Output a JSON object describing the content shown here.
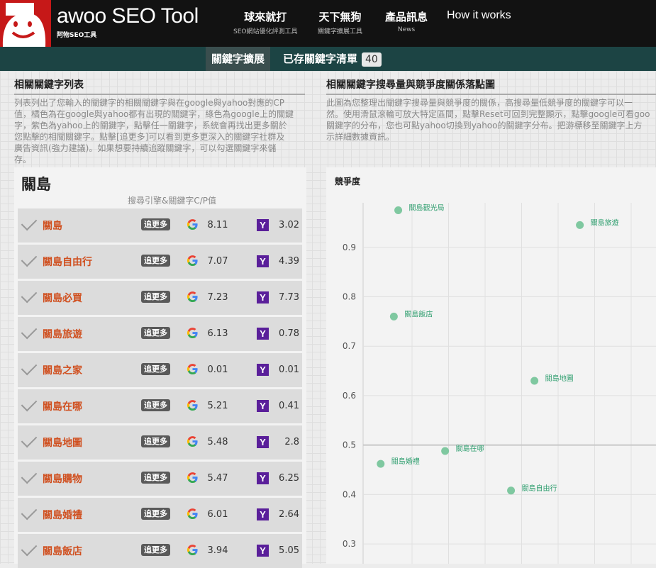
{
  "header": {
    "brand": "awoo SEO Tool",
    "brand_sub": "阿物SEO工具",
    "nav": [
      {
        "label": "球來就打",
        "sub": "SEO網站優化評測工具"
      },
      {
        "label": "天下無狗",
        "sub": "關鍵字擴展工具"
      },
      {
        "label": "產品訊息",
        "sub": "News"
      },
      {
        "label": "How it works",
        "sub": ""
      }
    ]
  },
  "subnav": {
    "tab_expand": "關鍵字擴展",
    "tab_saved": "已存關鍵字清單",
    "saved_count": "40"
  },
  "left": {
    "title": "相關關鍵字列表",
    "desc_lines": [
      "列表列出了您輸入的關鍵字的相關關鍵字與在google與yahoo對應的CP",
      "值，橘色為在google與yahoo都有出現的關鍵字，綠色為google上的關鍵",
      "字，紫色為yahoo上的關鍵字，點擊任一關鍵字，系統會再找出更多關於",
      "您點擊的相關關鍵字。點擊[追更多]可以看到更多更深入的關鍵字社群及",
      "廣告資訊(強力建議)。如果想要持續追蹤關鍵字，可以勾選關鍵字來儲",
      "存。"
    ],
    "keyword": "關島",
    "col_header": "搜尋引擎&關鍵字C/P值",
    "more_label": "追更多",
    "rows": [
      {
        "kw": "關島",
        "g": "8.11",
        "y": "3.02"
      },
      {
        "kw": "關島自由行",
        "g": "7.07",
        "y": "4.39"
      },
      {
        "kw": "關島必買",
        "g": "7.23",
        "y": "7.73"
      },
      {
        "kw": "關島旅遊",
        "g": "6.13",
        "y": "0.78"
      },
      {
        "kw": "關島之家",
        "g": "0.01",
        "y": "0.01"
      },
      {
        "kw": "關島在哪",
        "g": "5.21",
        "y": "0.41"
      },
      {
        "kw": "關島地圖",
        "g": "5.48",
        "y": "2.8"
      },
      {
        "kw": "關島購物",
        "g": "5.47",
        "y": "6.25"
      },
      {
        "kw": "關島婚禮",
        "g": "6.01",
        "y": "2.64"
      },
      {
        "kw": "關島飯店",
        "g": "3.94",
        "y": "5.05"
      }
    ]
  },
  "right": {
    "title": "相關關鍵字搜尋量與競爭度關係落點圖",
    "desc_lines": [
      "此圖為您整理出關鍵字搜尋量與競爭度的關係，高搜尋量低競爭度的關鍵字可以一",
      "然。使用滑鼠滾輪可放大特定區間，點擊Reset可回到完整顯示，點擊google可看goo",
      "關鍵字的分布，您也可點yahoo切換到yahoo的關鍵字分布。把游標移至關鍵字上方",
      "示詳細數據資訊。"
    ]
  },
  "chart_data": {
    "type": "scatter",
    "ylabel": "競爭度",
    "xlabel": "",
    "ylim": [
      0.26,
      0.99
    ],
    "yticks": [
      0.3,
      0.4,
      0.5,
      0.6,
      0.7,
      0.8,
      0.9
    ],
    "grid": true,
    "point_color": "#7fc8a0",
    "label_color": "#2e9e6e",
    "points": [
      {
        "label": "關島觀光局",
        "x": 0.12,
        "y": 0.975
      },
      {
        "label": "關島旅遊",
        "x": 0.74,
        "y": 0.945
      },
      {
        "label": "關島飯店",
        "x": 0.105,
        "y": 0.76
      },
      {
        "label": "關島地圖",
        "x": 0.585,
        "y": 0.63
      },
      {
        "label": "關島在哪",
        "x": 0.28,
        "y": 0.488
      },
      {
        "label": "關島婚禮",
        "x": 0.06,
        "y": 0.462
      },
      {
        "label": "關島自由行",
        "x": 0.505,
        "y": 0.408
      }
    ]
  }
}
